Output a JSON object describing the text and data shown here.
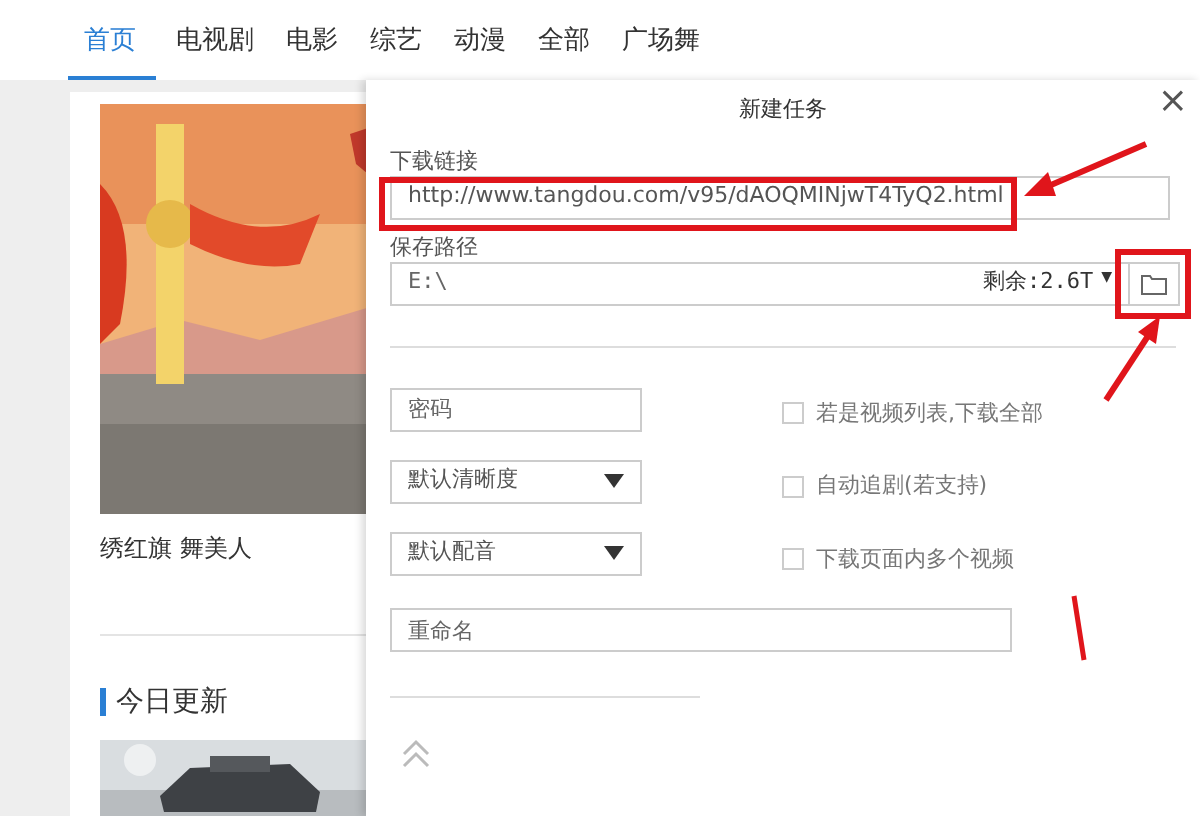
{
  "nav_tabs": [
    {
      "label": "首页",
      "selected": true
    },
    {
      "label": "电视剧",
      "selected": false
    },
    {
      "label": "电影",
      "selected": false
    },
    {
      "label": "综艺",
      "selected": false
    },
    {
      "label": "动漫",
      "selected": false
    },
    {
      "label": "全部",
      "selected": false
    },
    {
      "label": "广场舞",
      "selected": false
    }
  ],
  "featured": {
    "kind": "picture",
    "caption": "绣红旗 舞美人"
  },
  "section": {
    "title": "今日更新"
  },
  "dialog": {
    "title": "新建任务",
    "close": "×",
    "link_label": "下载链接",
    "link_value": "http://www.tangdou.com/v95/dAOQMINjwT4TyQ2.html",
    "path_label": "保存路径",
    "path_value": "E:\\",
    "space": "剩余:2.6T",
    "space_caret": "▼",
    "inputs": [
      {
        "kind": "input",
        "placeholder": "密码"
      },
      {
        "kind": "select",
        "value": "默认清晰度"
      },
      {
        "kind": "select",
        "value": "默认配音"
      }
    ],
    "options": [
      {
        "label": "若是视频列表,下载全部",
        "checked": false
      },
      {
        "label": "自动追剧(若支持)",
        "checked": false
      },
      {
        "label": "下载页面内多个视频",
        "checked": false
      }
    ],
    "rename": {
      "placeholder": "重命名"
    }
  }
}
